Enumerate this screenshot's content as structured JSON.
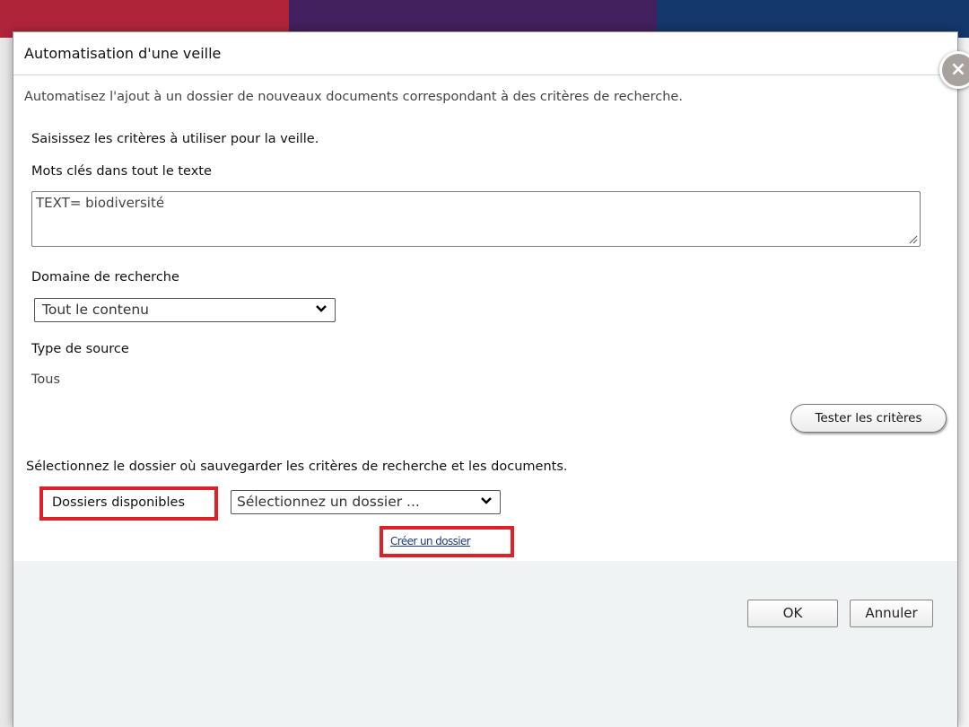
{
  "dialog": {
    "title": "Automatisation d'une veille",
    "close_label": "×",
    "intro": "Automatisez l'ajout à un dossier de nouveaux documents correspondant à des critères de recherche.",
    "criteria_label": "Saisissez les critères à utiliser pour la veille.",
    "keywords": {
      "label": "Mots clés dans tout le texte",
      "value": "TEXT= biodiversité"
    },
    "domain": {
      "label": "Domaine de recherche",
      "selected": "Tout le contenu"
    },
    "source_type": {
      "label": "Type de source",
      "value": "Tous"
    },
    "test_button": "Tester les critères",
    "folder_instructions": "Sélectionnez le dossier où sauvegarder les critères de recherche et les documents.",
    "folders": {
      "label": "Dossiers disponibles",
      "selected": "Sélectionnez un dossier ..."
    },
    "create_folder_link": "Créer un dossier",
    "ok_button": "OK",
    "cancel_button": "Annuler"
  },
  "colors": {
    "highlight": "#e02027",
    "link": "#1d3b7a",
    "close_button": "#a9a19b",
    "footer_bg": "#f0f3f4"
  },
  "icons": {
    "close": "close-icon",
    "dropdown": "chevron-down-icon"
  }
}
